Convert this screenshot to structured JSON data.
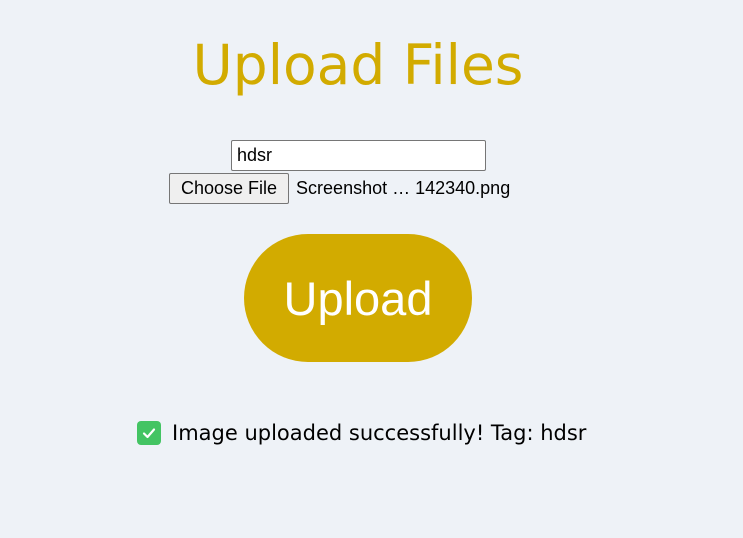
{
  "page": {
    "title": "Upload Files"
  },
  "form": {
    "tag_value": "hdsr",
    "choose_file_label": "Choose File",
    "selected_file_name": "Screenshot … 142340.png",
    "upload_label": "Upload"
  },
  "status": {
    "icon": "check-icon",
    "message": "Image uploaded successfully! Tag: hdsr"
  },
  "colors": {
    "accent": "#d2ab00",
    "background": "#eef2f7",
    "success": "#43c463"
  }
}
